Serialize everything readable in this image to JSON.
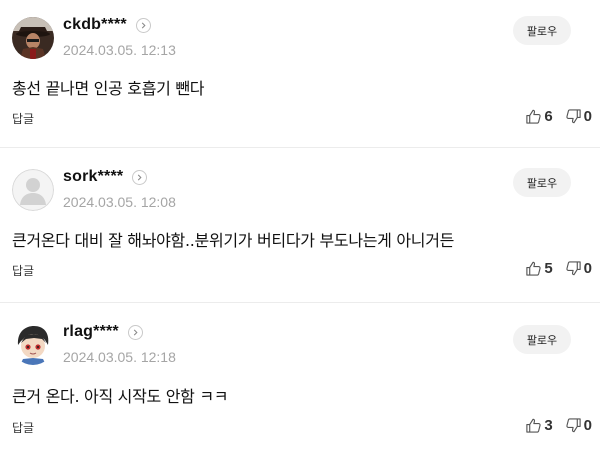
{
  "comments": [
    {
      "username": "ckdb****",
      "timestamp": "2024.03.05. 12:13",
      "text": "총선 끝나면 인공 호흡기 뺀다",
      "follow_label": "팔로우",
      "reply_label": "답글",
      "likes": "6",
      "dislikes": "0",
      "avatar": "user-photo"
    },
    {
      "username": "sork****",
      "timestamp": "2024.03.05. 12:08",
      "text": "큰거온다 대비 잘 해놔야함..분위기가 버티다가 부도나는게 아니거든",
      "follow_label": "팔로우",
      "reply_label": "답글",
      "likes": "5",
      "dislikes": "0",
      "avatar": "default-avatar"
    },
    {
      "username": "rlag****",
      "timestamp": "2024.03.05. 12:18",
      "text": "큰거 온다. 아직 시작도 안함 ㅋㅋ",
      "follow_label": "팔로우",
      "reply_label": "답글",
      "likes": "3",
      "dislikes": "0",
      "avatar": "cartoon-avatar"
    }
  ],
  "colors": {
    "text": "#111111",
    "muted": "#a5a5a5",
    "follow_bg": "#f2f2f2",
    "divider": "#ececec"
  },
  "icons": [
    "profile-chevron-icon",
    "thumbs-up-icon",
    "thumbs-down-icon"
  ]
}
